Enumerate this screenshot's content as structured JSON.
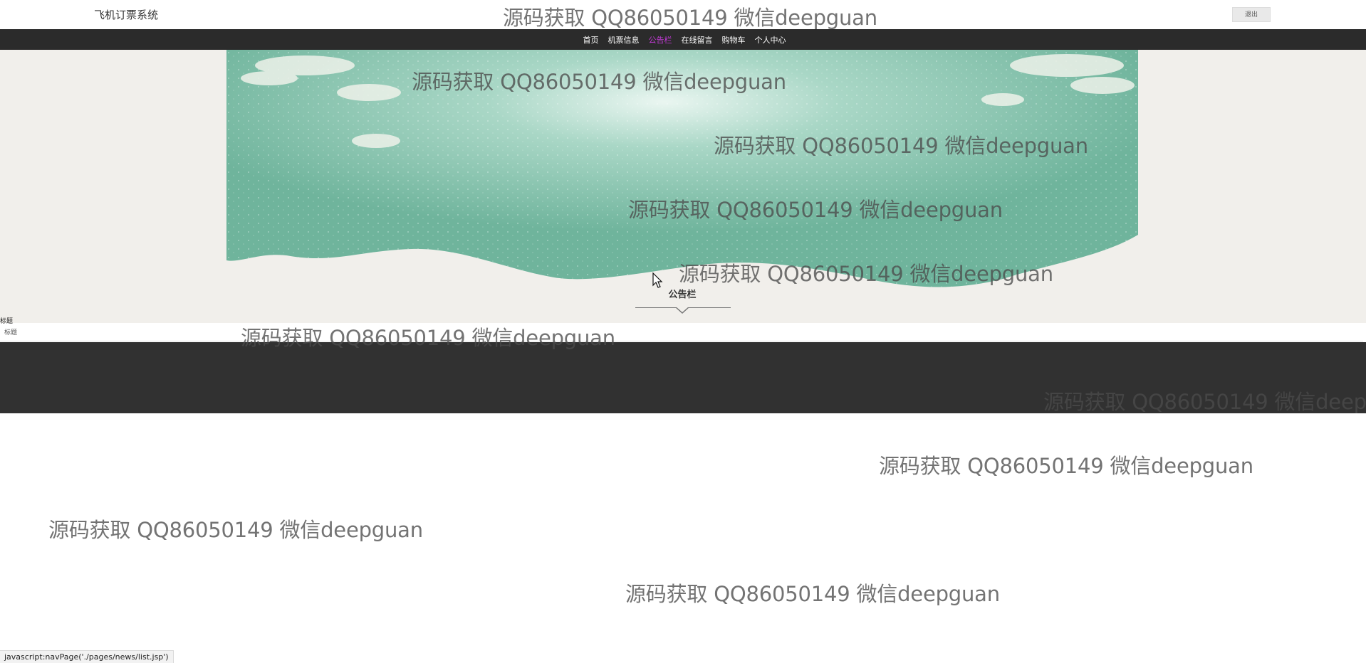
{
  "header": {
    "site_title": "飞机订票系统",
    "logout_label": "退出"
  },
  "nav": {
    "items": [
      {
        "label": "首页",
        "active": false
      },
      {
        "label": "机票信息",
        "active": false
      },
      {
        "label": "公告栏",
        "active": true
      },
      {
        "label": "在线留言",
        "active": false
      },
      {
        "label": "购物车",
        "active": false
      },
      {
        "label": "个人中心",
        "active": false
      }
    ],
    "active_color": "#c33ad7"
  },
  "section": {
    "title": "公告栏"
  },
  "list": {
    "header_label": "标题",
    "rows": [
      {
        "title": "标题"
      }
    ]
  },
  "watermark": {
    "text": "源码获取 QQ86050149 微信deepguan"
  },
  "statusbar": {
    "text": "javascript:navPage('./pages/news/list.jsp')"
  },
  "colors": {
    "navbar_bg": "#2b2b2b",
    "banner_green": "#7fbfa8",
    "hero_bg": "#f1efeb",
    "footer_bg": "#313131"
  },
  "icons": {
    "cursor": "mouse-pointer-icon",
    "caret": "caret-down-icon"
  }
}
